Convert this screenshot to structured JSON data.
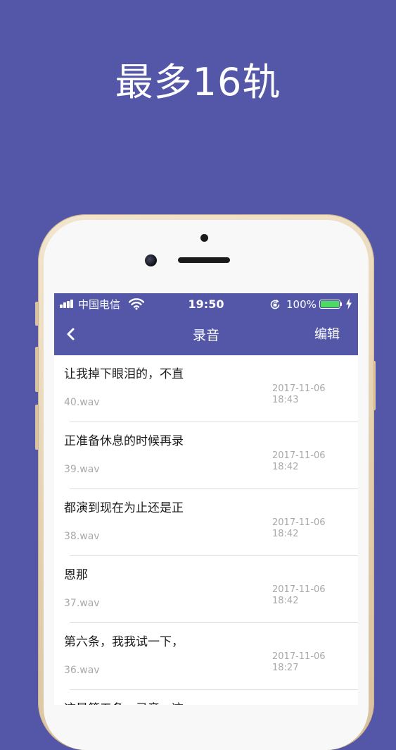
{
  "promo": {
    "headline": "最多16轨"
  },
  "status_bar": {
    "carrier": "中国电信",
    "time": "19:50",
    "battery_percent": "100%",
    "battery_level": 1.0,
    "battery_color": "#4cd964"
  },
  "nav": {
    "title": "录音",
    "edit_label": "编辑"
  },
  "recordings": [
    {
      "title": "让我掉下眼泪的，不直",
      "file": "40.wav",
      "date": "2017-11-06",
      "time": "18:43"
    },
    {
      "title": "正准备休息的时候再录",
      "file": "39.wav",
      "date": "2017-11-06",
      "time": "18:42"
    },
    {
      "title": "都演到现在为止还是正",
      "file": "38.wav",
      "date": "2017-11-06",
      "time": "18:42"
    },
    {
      "title": "恩那",
      "file": "37.wav",
      "date": "2017-11-06",
      "time": "18:42"
    },
    {
      "title": "第六条，我我试一下，",
      "file": "36.wav",
      "date": "2017-11-06",
      "time": "18:27"
    },
    {
      "title": "这是第五条，录音，这",
      "file": "",
      "date": "",
      "time": ""
    }
  ],
  "colors": {
    "background": "#5457a8",
    "nav_bar": "#5457a8",
    "secondary_text": "#a9a9a9"
  },
  "icons": {
    "back": "chevron-left-icon",
    "signal": "cellular-signal-icon",
    "wifi": "wifi-icon",
    "rotation_lock": "rotation-lock-icon",
    "battery": "battery-icon",
    "charging": "charging-bolt-icon"
  }
}
